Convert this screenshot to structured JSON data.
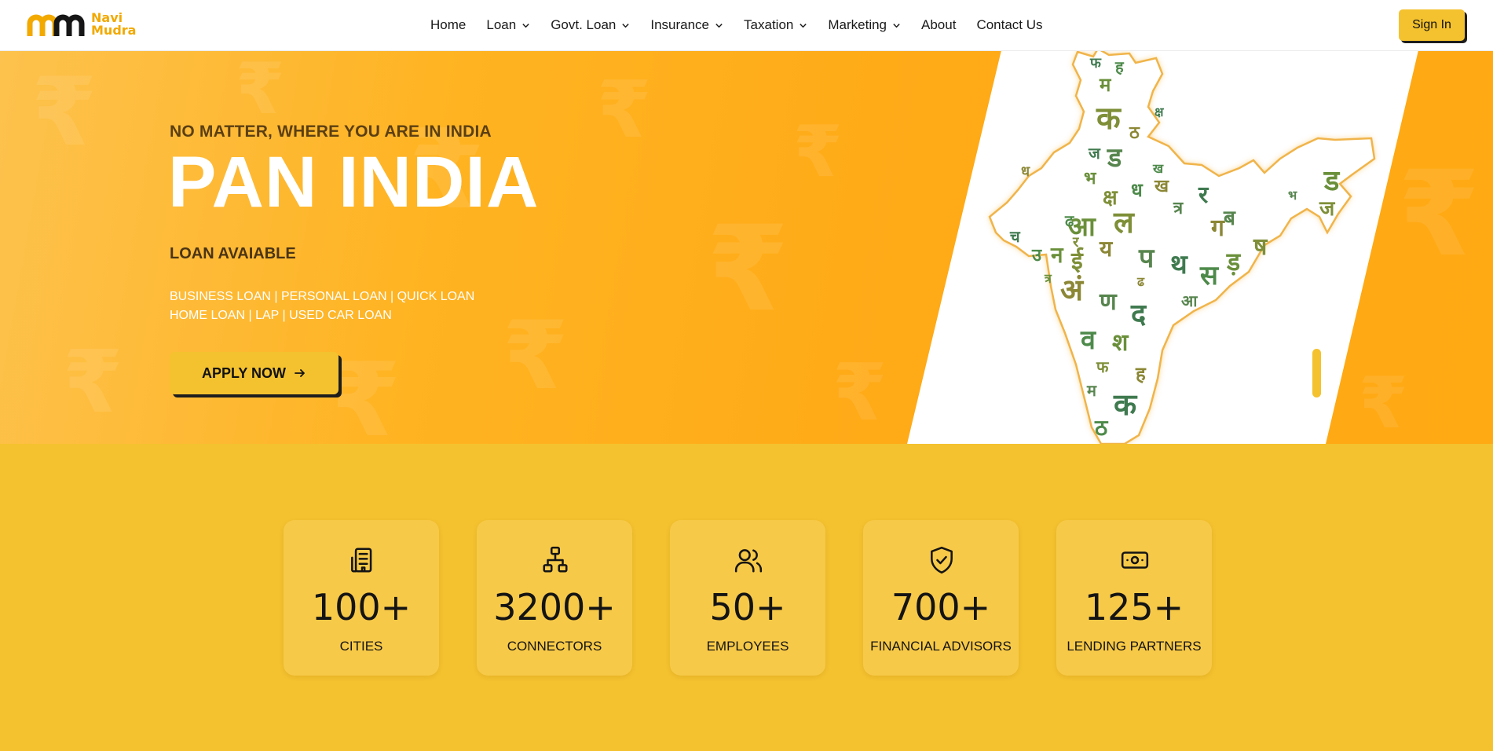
{
  "brand": {
    "line1": "Navi",
    "line2": "Mudra",
    "color": "#f2a900"
  },
  "nav": {
    "items": [
      {
        "label": "Home",
        "dropdown": false
      },
      {
        "label": "Loan",
        "dropdown": true
      },
      {
        "label": "Govt. Loan",
        "dropdown": true
      },
      {
        "label": "Insurance",
        "dropdown": true
      },
      {
        "label": "Taxation",
        "dropdown": true
      },
      {
        "label": "Marketing",
        "dropdown": true
      },
      {
        "label": "About",
        "dropdown": false
      },
      {
        "label": "Contact Us",
        "dropdown": false
      }
    ],
    "signin_label": "Sign In"
  },
  "hero": {
    "subtitle": "NO MATTER, WHERE YOU ARE IN INDIA",
    "title": "PAN INDIA",
    "tagline": "LOAN AVAIABLE",
    "line1": "BUSINESS LOAN | PERSONAL LOAN | QUICK LOAN",
    "line2": "HOME LOAN | LAP | USED CAR LOAN",
    "cta_label": "APPLY NOW",
    "map_glyphs": [
      "फ",
      "ह",
      "म",
      "क",
      "ठ",
      "ड",
      "ज",
      "ध",
      "भ",
      "क्ष",
      "ख",
      "त्र",
      "र",
      "ढ",
      "आ",
      "ल",
      "ग",
      "ब",
      "च",
      "उ",
      "न",
      "ई",
      "य",
      "प",
      "थ",
      "स",
      "ड़",
      "ष",
      "अं",
      "ण",
      "द",
      "व",
      "श"
    ]
  },
  "stats": [
    {
      "icon": "building-icon",
      "value": "100+",
      "label": "CITIES"
    },
    {
      "icon": "network-icon",
      "value": "3200+",
      "label": "CONNECTORS"
    },
    {
      "icon": "users-icon",
      "value": "50+",
      "label": "EMPLOYEES"
    },
    {
      "icon": "shield-check-icon",
      "value": "700+",
      "label": "FINANCIAL ADVISORS"
    },
    {
      "icon": "banknote-icon",
      "value": "125+",
      "label": "LENDING PARTNERS"
    }
  ],
  "colors": {
    "accent": "#f4c22f",
    "hero_orange": "#ffaa17",
    "text_dark": "#141414",
    "map_green": "#3f7a4f"
  }
}
